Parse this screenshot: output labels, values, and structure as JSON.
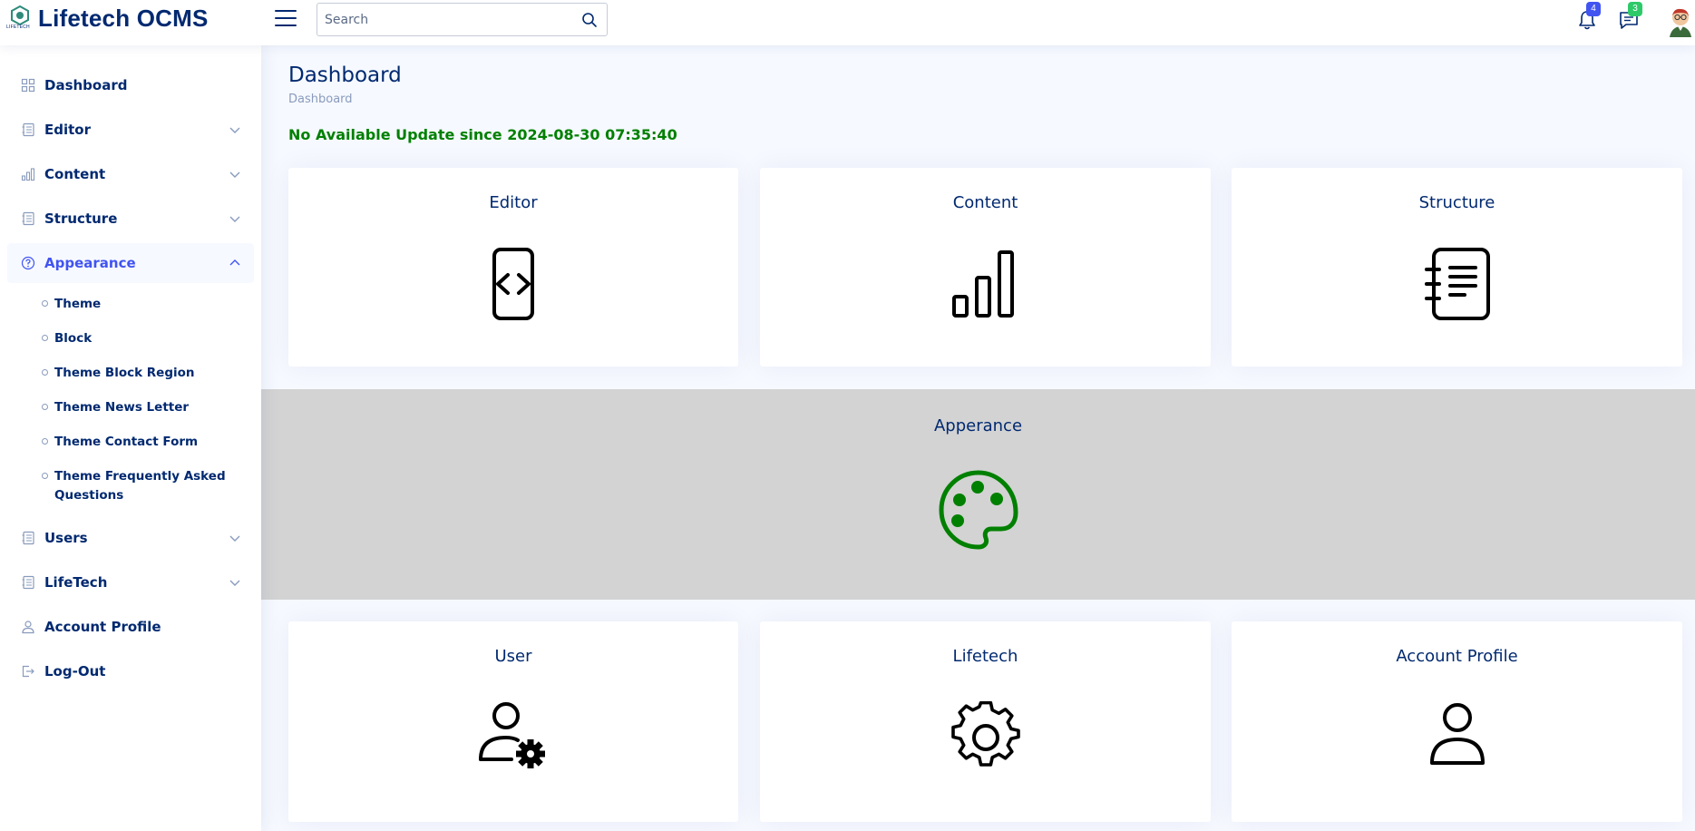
{
  "header": {
    "brand": "Lifetech OCMS",
    "logo_small_text": "LIFETECH",
    "search_placeholder": "Search",
    "notifications_count": "4",
    "messages_count": "3",
    "colors": {
      "notif_badge": "#4154f1",
      "msg_badge": "#2eca6a"
    }
  },
  "sidebar": {
    "items": [
      {
        "label": "Dashboard",
        "icon": "grid-icon"
      },
      {
        "label": "Editor",
        "icon": "journal-icon"
      },
      {
        "label": "Content",
        "icon": "bar-chart-icon"
      },
      {
        "label": "Structure",
        "icon": "journal-icon"
      },
      {
        "label": "Appearance",
        "icon": "question-circle-icon"
      },
      {
        "label": "Users",
        "icon": "journal-icon"
      },
      {
        "label": "LifeTech",
        "icon": "journal-icon"
      },
      {
        "label": "Account Profile",
        "icon": "person-icon"
      },
      {
        "label": "Log-Out",
        "icon": "logout-icon"
      }
    ],
    "appearance_sub": [
      "Theme",
      "Block",
      "Theme Block Region",
      "Theme News Letter",
      "Theme Contact Form",
      "Theme Frequently Asked Questions"
    ]
  },
  "main": {
    "title": "Dashboard",
    "breadcrumb": "Dashboard",
    "update_message": "No Available Update since 2024-08-30 07:35:40",
    "cards": {
      "editor": "Editor",
      "content": "Content",
      "structure": "Structure",
      "appearance": "Apperance",
      "user": "User",
      "lifetech": "Lifetech",
      "account": "Account Profile"
    },
    "colors": {
      "accent": "#4154f1",
      "update_green": "#008000",
      "palette_green": "#008000",
      "band_gray": "#d3d3d3"
    }
  }
}
